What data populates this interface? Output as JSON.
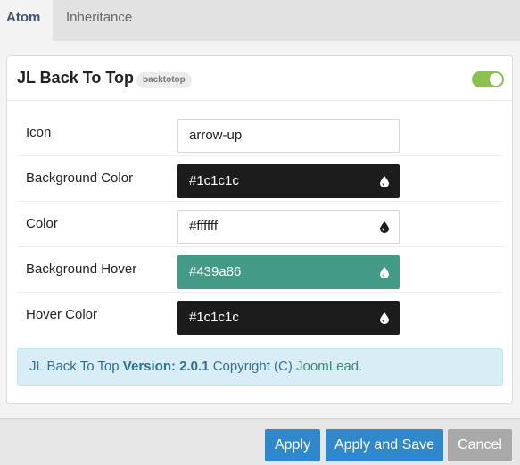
{
  "tabs": [
    {
      "label": "Atom",
      "active": true
    },
    {
      "label": "Inheritance",
      "active": false
    }
  ],
  "card": {
    "title": "JL Back To Top",
    "badge": "backtotop",
    "enabled": true,
    "accent_color": "#8cc152"
  },
  "fields": [
    {
      "label": "Icon",
      "value": "arrow-up",
      "type": "text"
    },
    {
      "label": "Background Color",
      "value": "#1c1c1c",
      "type": "color",
      "swatch": "#1c1c1c"
    },
    {
      "label": "Color",
      "value": "#ffffff",
      "type": "color",
      "swatch": "#ffffff"
    },
    {
      "label": "Background Hover",
      "value": "#439a86",
      "type": "color",
      "swatch": "#439a86"
    },
    {
      "label": "Hover Color",
      "value": "#1c1c1c",
      "type": "color",
      "swatch": "#1c1c1c"
    }
  ],
  "info": {
    "name": "JL Back To Top",
    "version_label": "Version: 2.0.1",
    "copyright": "Copyright (C)",
    "link": "JoomLead."
  },
  "footer": {
    "apply": "Apply",
    "apply_save": "Apply and Save",
    "cancel": "Cancel"
  }
}
